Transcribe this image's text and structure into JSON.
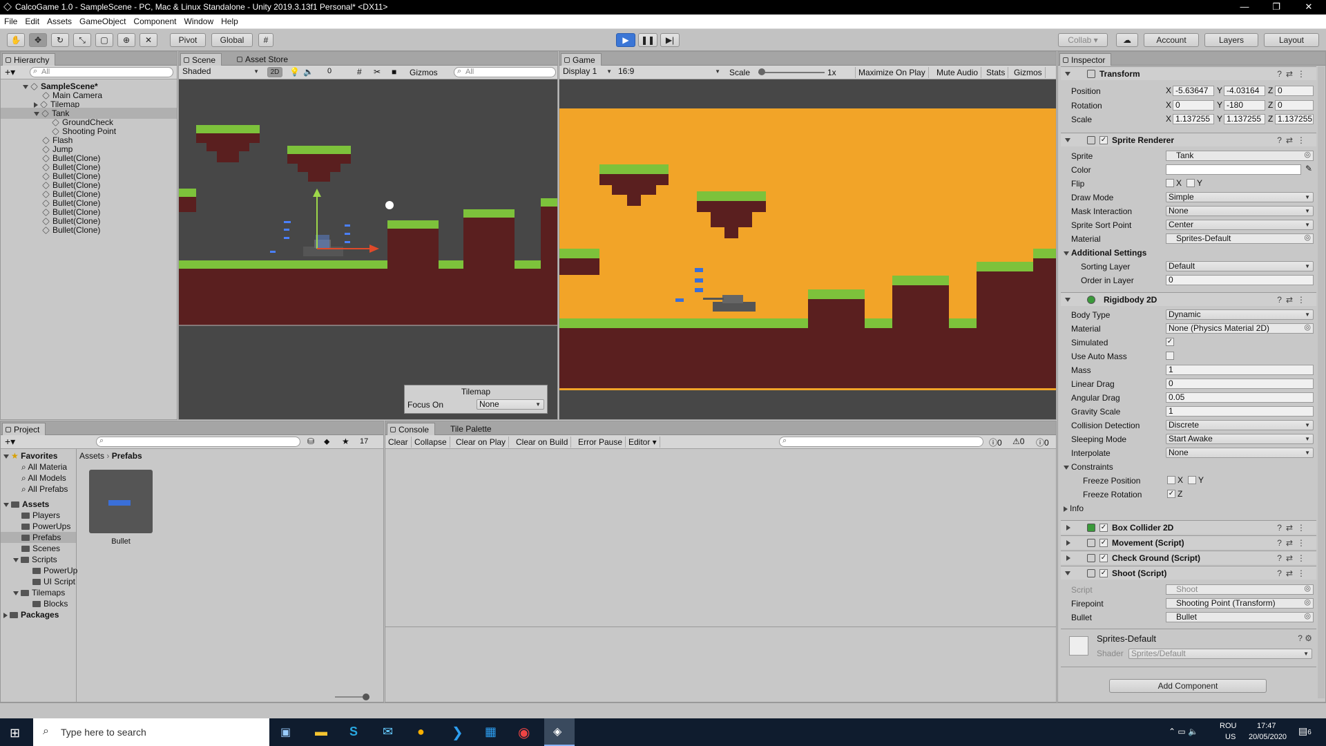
{
  "window": {
    "title": "CalcoGame 1.0 - SampleScene - PC, Mac & Linux Standalone - Unity 2019.3.13f1 Personal* <DX11>",
    "minimize": "—",
    "maximize": "❐",
    "close": "✕"
  },
  "menu": [
    "File",
    "Edit",
    "Assets",
    "GameObject",
    "Component",
    "Window",
    "Help"
  ],
  "toolbar": {
    "pivot": "Pivot",
    "global": "Global",
    "collab": "Collab ▾",
    "account": "Account",
    "layers": "Layers",
    "layout": "Layout"
  },
  "hierarchy": {
    "tab": "Hierarchy",
    "search": "All",
    "scene": "SampleScene*",
    "items": [
      "Main Camera",
      "Tilemap",
      "Tank",
      "GroundCheck",
      "Shooting Point",
      "Flash",
      "Jump",
      "Bullet(Clone)",
      "Bullet(Clone)",
      "Bullet(Clone)",
      "Bullet(Clone)",
      "Bullet(Clone)",
      "Bullet(Clone)",
      "Bullet(Clone)",
      "Bullet(Clone)",
      "Bullet(Clone)"
    ]
  },
  "scene": {
    "tab": "Scene",
    "tab2": "Asset Store",
    "shading": "Shaded",
    "mode2d": "2D",
    "hidden": "0",
    "gizmos": "Gizmos",
    "search": "All",
    "overlay": {
      "title": "Tilemap",
      "focus_label": "Focus On",
      "focus_value": "None"
    }
  },
  "game": {
    "tab": "Game",
    "display": "Display 1",
    "aspect": "16:9",
    "scale_label": "Scale",
    "scale_value": "1x",
    "maximize": "Maximize On Play",
    "mute": "Mute Audio",
    "stats": "Stats",
    "gizmos": "Gizmos"
  },
  "project": {
    "tab": "Project",
    "hidden_count": "17",
    "favorites": "Favorites",
    "fav_items": [
      "All Materia",
      "All Models",
      "All Prefabs"
    ],
    "assets": "Assets",
    "asset_folders": [
      "Players",
      "PowerUps",
      "Prefabs",
      "Scenes",
      "Scripts",
      "PowerUp",
      "UI Script",
      "Tilemaps",
      "Blocks"
    ],
    "packages": "Packages",
    "breadcrumb": [
      "Assets",
      "Prefabs"
    ],
    "item": "Bullet"
  },
  "console": {
    "tab": "Console",
    "tab2": "Tile Palette",
    "buttons": [
      "Clear",
      "Collapse",
      "Clear on Play",
      "Clear on Build",
      "Error Pause",
      "Editor ▾"
    ],
    "counts": [
      "0",
      "0",
      "0"
    ]
  },
  "inspector": {
    "tab": "Inspector",
    "transform": {
      "title": "Transform",
      "position": {
        "label": "Position",
        "x": "-5.63647",
        "y": "-4.03164",
        "z": "0"
      },
      "rotation": {
        "label": "Rotation",
        "x": "0",
        "y": "-180",
        "z": "0"
      },
      "scale": {
        "label": "Scale",
        "x": "1.137255",
        "y": "1.137255",
        "z": "1.137255"
      }
    },
    "sprite_renderer": {
      "title": "Sprite Renderer",
      "sprite_label": "Sprite",
      "sprite": "Tank",
      "color_label": "Color",
      "flip_label": "Flip",
      "flip_x": "X",
      "flip_y": "Y",
      "draw_mode_label": "Draw Mode",
      "draw_mode": "Simple",
      "mask_label": "Mask Interaction",
      "mask": "None",
      "sort_point_label": "Sprite Sort Point",
      "sort_point": "Center",
      "material_label": "Material",
      "material": "Sprites-Default",
      "additional": "Additional Settings",
      "sorting_layer_label": "Sorting Layer",
      "sorting_layer": "Default",
      "order_label": "Order in Layer",
      "order": "0"
    },
    "rigidbody": {
      "title": "Rigidbody 2D",
      "body_type_label": "Body Type",
      "body_type": "Dynamic",
      "material_label": "Material",
      "material": "None (Physics Material 2D)",
      "simulated_label": "Simulated",
      "auto_mass_label": "Use Auto Mass",
      "mass_label": "Mass",
      "mass": "1",
      "linear_drag_label": "Linear Drag",
      "linear_drag": "0",
      "angular_drag_label": "Angular Drag",
      "angular_drag": "0.05",
      "gravity_label": "Gravity Scale",
      "gravity": "1",
      "collision_label": "Collision Detection",
      "collision": "Discrete",
      "sleeping_label": "Sleeping Mode",
      "sleeping": "Start Awake",
      "interpolate_label": "Interpolate",
      "interpolate": "None",
      "constraints": "Constraints",
      "freeze_pos": "Freeze Position",
      "freeze_rot": "Freeze Rotation",
      "x": "X",
      "y": "Y",
      "z": "Z",
      "info": "Info"
    },
    "box_collider": "Box Collider 2D",
    "movement": "Movement (Script)",
    "check_ground": "Check Ground (Script)",
    "shoot": {
      "title": "Shoot (Script)",
      "script_label": "Script",
      "script": "Shoot",
      "firepoint_label": "Firepoint",
      "firepoint": "Shooting Point (Transform)",
      "bullet_label": "Bullet",
      "bullet": "Bullet"
    },
    "material": {
      "name": "Sprites-Default",
      "shader_label": "Shader",
      "shader": "Sprites/Default"
    },
    "add_component": "Add Component"
  },
  "taskbar": {
    "search": "Type here to search",
    "lang": "ROU",
    "region": "US",
    "time": "17:47",
    "date": "20/05/2020",
    "notif": "6"
  },
  "colors": {
    "game_sky": "#f2a428",
    "grass": "#7dc23b",
    "dirt": "#5a1f1f",
    "scene_bg": "#474747",
    "accent": "#3b76d6"
  }
}
